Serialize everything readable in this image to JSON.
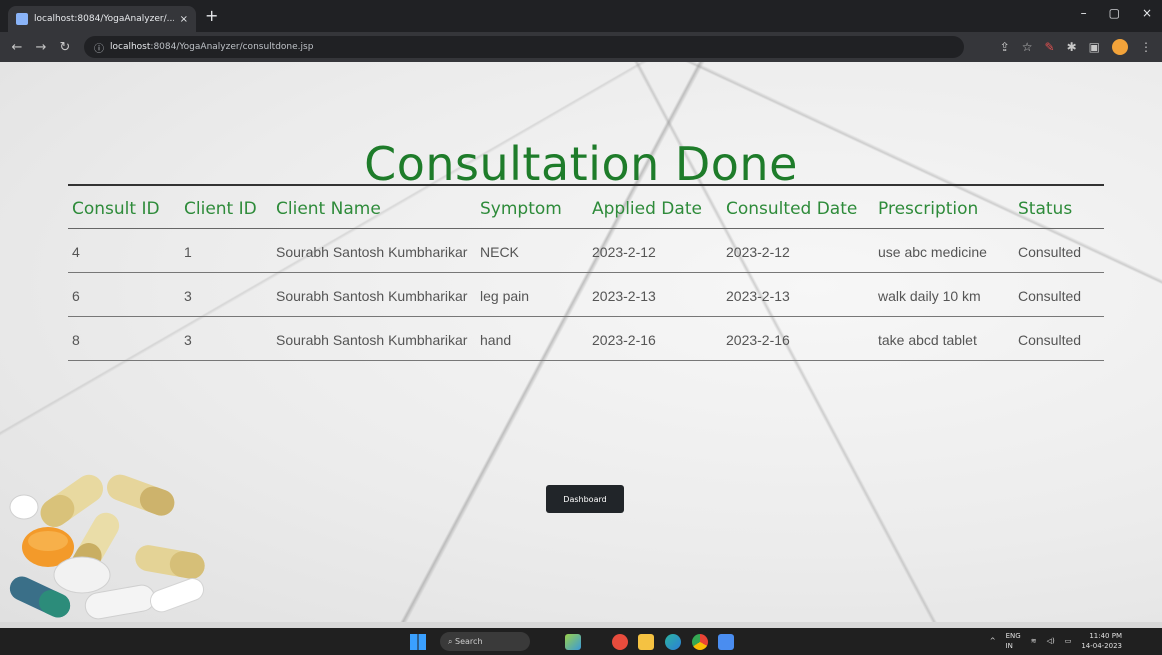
{
  "browser": {
    "tab_title": "localhost:8084/YogaAnalyzer/...",
    "tab_close": "×",
    "new_tab": "+",
    "url_host": "localhost",
    "url_path": ":8084/YogaAnalyzer/consultdone.jsp",
    "window_controls": {
      "minimize": "–",
      "maximize": "▢",
      "close": "×"
    }
  },
  "page": {
    "title": "Consultation Done",
    "table": {
      "headers": {
        "consult_id": "Consult ID",
        "client_id": "Client ID",
        "client_name": "Client Name",
        "symptom": "Symptom",
        "applied_date": "Applied Date",
        "consulted_date": "Consulted Date",
        "prescription": "Prescription",
        "status": "Status"
      },
      "rows": [
        {
          "consult_id": "4",
          "client_id": "1",
          "client_name": "Sourabh Santosh Kumbharikar",
          "symptom": "NECK",
          "applied_date": "2023-2-12",
          "consulted_date": "2023-2-12",
          "prescription": "use abc medicine",
          "status": "Consulted"
        },
        {
          "consult_id": "6",
          "client_id": "3",
          "client_name": "Sourabh Santosh Kumbharikar",
          "symptom": "leg pain",
          "applied_date": "2023-2-13",
          "consulted_date": "2023-2-13",
          "prescription": "walk daily 10 km",
          "status": "Consulted"
        },
        {
          "consult_id": "8",
          "client_id": "3",
          "client_name": "Sourabh Santosh Kumbharikar",
          "symptom": "hand",
          "applied_date": "2023-2-16",
          "consulted_date": "2023-2-16",
          "prescription": "take abcd tablet",
          "status": "Consulted"
        }
      ]
    },
    "dashboard_button": "Dashboard"
  },
  "taskbar": {
    "search_label": "Search",
    "tray_lang": "ENG",
    "tray_region": "IN",
    "clock_time": "11:40 PM",
    "clock_date": "14-04-2023"
  },
  "colors": {
    "title_green": "#1e7c2a",
    "header_green": "#2e8b3a",
    "button_dark": "#212529"
  }
}
